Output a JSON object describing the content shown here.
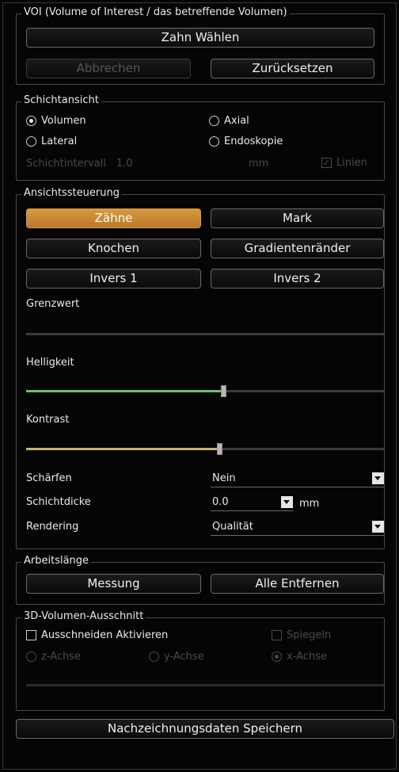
{
  "voi": {
    "title": "VOI (Volume of Interest / das betreffende Volumen)",
    "select_tooth": "Zahn Wählen",
    "cancel": "Abbrechen",
    "reset": "Zurücksetzen"
  },
  "slice": {
    "title": "Schichtansicht",
    "volume": "Volumen",
    "axial": "Axial",
    "lateral": "Lateral",
    "endoscopy": "Endoskopie",
    "interval_label": "Schichtintervall",
    "interval_value": "1.0",
    "unit": "mm",
    "lines": "Linien",
    "selected": "Volumen"
  },
  "view": {
    "title": "Ansichtssteuerung",
    "teeth": "Zähne",
    "marrow": "Mark",
    "bone": "Knochen",
    "gradient": "Gradientenränder",
    "invert1": "Invers 1",
    "invert2": "Invers 2",
    "threshold_label": "Grenzwert",
    "brightness_label": "Helligkeit",
    "brightness_level": 0.55,
    "contrast_label": "Kontrast",
    "contrast_level": 0.54,
    "sharpen_label": "Schärfen",
    "sharpen_value": "Nein",
    "thickness_label": "Schichtdicke",
    "thickness_value": "0.0",
    "thickness_unit": "mm",
    "rendering_label": "Rendering",
    "rendering_value": "Qualität",
    "accent_color": "#c98a35",
    "brightness_color": "#6cc06c",
    "contrast_color": "#c8b27a"
  },
  "work": {
    "title": "Arbeitslänge",
    "measure": "Messung",
    "remove_all": "Alle Entfernen"
  },
  "crop": {
    "title": "3D-Volumen-Ausschnitt",
    "enable": "Ausschneiden Aktivieren",
    "mirror": "Spiegeln",
    "z_axis": "z-Achse",
    "y_axis": "y-Achse",
    "x_axis": "x-Achse"
  },
  "save_trace": "Nachzeichnungsdaten Speichern"
}
